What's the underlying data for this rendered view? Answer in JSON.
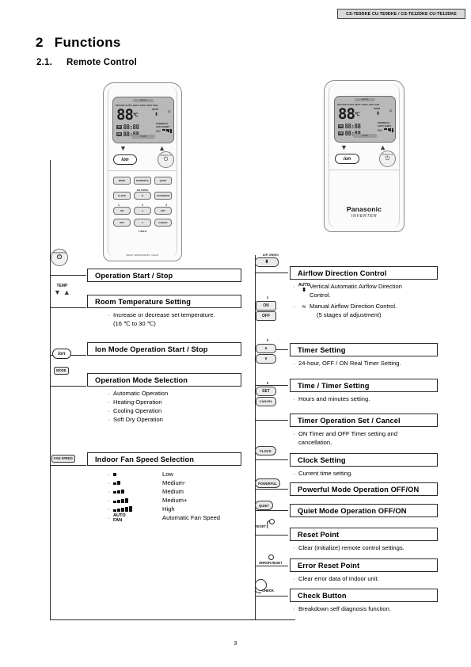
{
  "header": {
    "model_codes": "CS-TE9DKE CU-TE9DKE / CS-TE12DKE CU-TE12DKE"
  },
  "titles": {
    "section_number": "2",
    "section_title": "Functions",
    "sub_number": "2.1.",
    "sub_title": "Remote Control"
  },
  "page_number": "3",
  "remote_display": {
    "top_cap": "MODE",
    "mode_labels": "OFF/ON AUTO HEAT COOL DRY ION",
    "temperature": "88",
    "temp_unit": "℃",
    "auto_label": "AUTO",
    "swing_icon": "⬍",
    "fan_icon": "≈",
    "timer_on_mark": "ON",
    "timer_on_value": "88:88",
    "timer_off_mark": "OFF",
    "timer_off_value": "88:88",
    "powerful_label": "POWERFUL",
    "quiet_label": "AUTO QUIET",
    "fan_label": "FAN",
    "bottom_cap": "TEMP"
  },
  "remote_buttons": {
    "mode": "MODE",
    "powerful": "POWERFUL",
    "quiet": "QUIET",
    "clock": "CLOCK",
    "airswing_label": "AIR SWING",
    "airswing_icon": "⬍",
    "fanspeed": "FAN SPEED",
    "on": "ON",
    "up": "∧",
    "set": "SET",
    "off": "OFF",
    "down": "∨",
    "cancel": "CANCEL",
    "num1": "1",
    "num2": "2",
    "num3": "3",
    "timer_foot": "TIMER",
    "reset_foot": "RESET / ERROR RESET / CHECK",
    "power_label": "OPERATION",
    "power_symbol": "⏻",
    "ion_label": "ion",
    "temp_down": "▼",
    "temp_up": "▲"
  },
  "brand": {
    "name": "Panasonic",
    "inverter": "INVERTER"
  },
  "left_column": [
    {
      "id": "operation-start-stop",
      "title": "Operation Start / Stop",
      "chip": "power",
      "bullets": []
    },
    {
      "id": "room-temperature-setting",
      "title": "Room Temperature Setting",
      "chip": "temp",
      "chip_label": "TEMP",
      "bullets": [
        "Increase or decrease set temperature.",
        "(16 ℃ to 30 ℃)"
      ]
    },
    {
      "id": "ion-mode-operation",
      "title": "Ion Mode Operation Start / Stop",
      "chip": "ion",
      "chip_label": "ion",
      "bullets": []
    },
    {
      "id": "operation-mode-selection",
      "title": "Operation Mode Selection",
      "chip": "mode",
      "chip_label": "MODE",
      "bullets": [
        "Automatic Operation",
        "Heating Operation",
        "Cooling Operation",
        "Soft Dry Operation"
      ]
    },
    {
      "id": "indoor-fan-speed-selection",
      "title": "Indoor Fan Speed Selection",
      "chip": "fanspeed",
      "chip_label": "FAN SPEED",
      "bullets": []
    }
  ],
  "fan_speeds": [
    {
      "bars": 1,
      "name": "Low"
    },
    {
      "bars": 2,
      "name": "Medium-"
    },
    {
      "bars": 3,
      "name": "Medium"
    },
    {
      "bars": 4,
      "name": "Medium+"
    },
    {
      "bars": 5,
      "name": "High"
    },
    {
      "bars": 0,
      "auto_line1": "AUTO",
      "auto_line2": "FAN",
      "name": "Automatic Fan Speed"
    }
  ],
  "right_column": [
    {
      "id": "airflow-direction-control",
      "title": "Airflow Direction Control",
      "chip_label": "AIR SWING"
    },
    {
      "id": "timer-setting",
      "title": "Timer Setting",
      "bullets": [
        "24-hour, OFF / ON Real Timer Setting."
      ]
    },
    {
      "id": "time-timer-setting",
      "title": "Time / Timer Setting",
      "bullets": [
        "Hours and minutes setting."
      ]
    },
    {
      "id": "timer-operation-set-cancel",
      "title": "Timer Operation Set / Cancel",
      "bullets": [
        "ON Timer and OFF Timer setting and",
        "cancellation."
      ]
    },
    {
      "id": "clock-setting",
      "title": "Clock Setting",
      "chip_label": "CLOCK",
      "bullets": [
        "Current time setting."
      ]
    },
    {
      "id": "powerful-mode",
      "title": "Powerful Mode Operation OFF/ON",
      "chip_label": "POWERFUL",
      "bullets": []
    },
    {
      "id": "quiet-mode",
      "title": "Quiet Mode Operation OFF/ON",
      "chip_label": "QUIET",
      "bullets": []
    },
    {
      "id": "reset-point",
      "title": "Reset Point",
      "chip_label": "RESET",
      "bullets": [
        "Clear (Initialize) remote control settings."
      ]
    },
    {
      "id": "error-reset-point",
      "title": "Error Reset Point",
      "chip_label": "ERROR RESET",
      "bullets": [
        "Clear error data of Indoor unit."
      ]
    },
    {
      "id": "check-button",
      "title": "Check Button",
      "chip_label": "CHECK",
      "bullets": [
        "Breakdown self diagnosis function."
      ]
    }
  ],
  "airflow_details": {
    "auto_label": "AUTO",
    "auto_icon": "⬍",
    "auto_text_line1": "Vertical Automatic Airflow Direction",
    "auto_text_line2": "Control.",
    "manual_icon": "≈",
    "manual_text_line1": "Manual Airflow Direction Control.",
    "manual_text_line2": "(5 stages of adjustment)"
  },
  "timer_chips": {
    "num1": "1",
    "on": "ON",
    "off": "OFF",
    "num2": "2",
    "up": "∧",
    "down": "∨",
    "num3": "3",
    "set": "SET",
    "cancel": "CANCEL"
  },
  "bullet_char": "·"
}
